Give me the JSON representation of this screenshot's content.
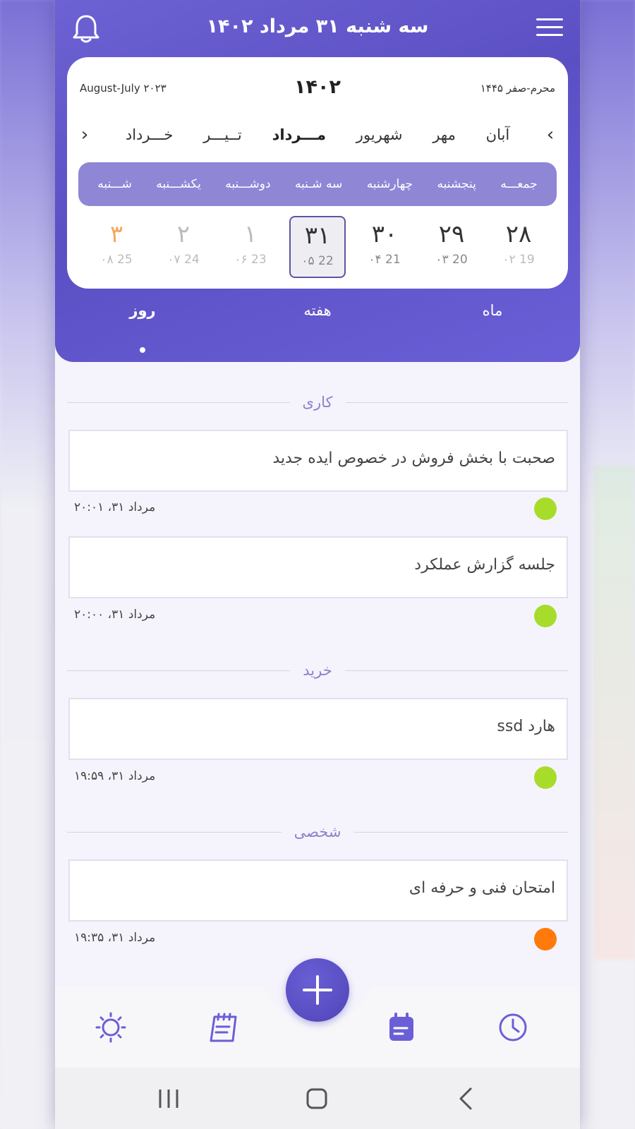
{
  "header": {
    "title": "سه شنبه ۳۱ مرداد ۱۴۰۲"
  },
  "calendar": {
    "gregorian_range": "August-July ۲۰۲۳",
    "year": "۱۴۰۲",
    "hijri_range": "محرم-صفر ۱۴۴۵",
    "months": [
      "خـــرداد",
      "تــیـــر",
      "مـــرداد",
      "شهریور",
      "مهر",
      "آبان"
    ],
    "weekdays": [
      "شـــنبه",
      "یکشـــنبه",
      "دوشـــنبه",
      "سه شـنبه",
      "چهارشنبه",
      "پنجشنبه",
      "جمعـــه"
    ],
    "days": [
      {
        "persian": "۲۸",
        "sub": "۰۲ 19"
      },
      {
        "persian": "۲۹",
        "sub": "۰۳ 20"
      },
      {
        "persian": "۳۰",
        "sub": "۰۴ 21"
      },
      {
        "persian": "۳۱",
        "sub": "۰۵ 22"
      },
      {
        "persian": "۱",
        "sub": "۰۶ 23"
      },
      {
        "persian": "۲",
        "sub": "۰۷ 24"
      },
      {
        "persian": "۳",
        "sub": "۰۸ 25"
      }
    ]
  },
  "tabs": [
    "روز",
    "هفته",
    "ماه"
  ],
  "sections": [
    {
      "label": "کاری",
      "tasks": [
        {
          "text": "صحبت با بخش فروش در خصوص ایده جدید",
          "time": "مرداد ۳۱، ۲۰:۰۱",
          "status_color": "#a8dc2b"
        },
        {
          "text": "جلسه گزارش عملکرد",
          "time": "مرداد ۳۱، ۲۰:۰۰",
          "status_color": "#a8dc2b"
        }
      ]
    },
    {
      "label": "خرید",
      "tasks": [
        {
          "text": "هارد ssd",
          "time": "مرداد ۳۱، ۱۹:۵۹",
          "status_color": "#a8dc2b"
        }
      ]
    },
    {
      "label": "شخصی",
      "tasks": [
        {
          "text": "امتحان فنی و حرفه ای",
          "time": "مرداد ۳۱، ۱۹:۳۵",
          "status_color": "#ff7a0a"
        }
      ]
    }
  ],
  "colors": {
    "accent": "#5b4fc4",
    "weekbar": "#8f86d6",
    "friday": "#f4a95a"
  }
}
